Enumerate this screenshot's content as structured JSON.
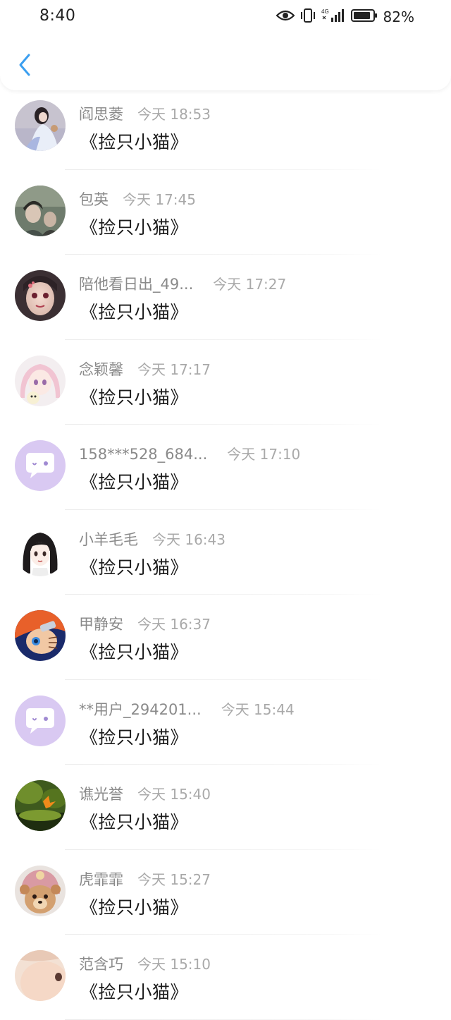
{
  "status_bar": {
    "time": "8:40",
    "battery_percent": "82%",
    "network": "4G",
    "icons": [
      "eye-icon",
      "vibrate-icon",
      "signal-icon",
      "battery-icon"
    ]
  },
  "header": {
    "back_icon": "chevron-left-icon",
    "accent_color": "#3b9ff0"
  },
  "list": [
    {
      "name": "阎思菱",
      "time": "今天 18:53",
      "content": "《捡只小猫》",
      "avatar": "photo"
    },
    {
      "name": "包英",
      "time": "今天 17:45",
      "content": "《捡只小猫》",
      "avatar": "photo"
    },
    {
      "name": "陪他看日出_49...",
      "time": "今天 17:27",
      "content": "《捡只小猫》",
      "avatar": "photo"
    },
    {
      "name": "念颖馨",
      "time": "今天 17:17",
      "content": "《捡只小猫》",
      "avatar": "photo"
    },
    {
      "name": "158***528_684...",
      "time": "今天 17:10",
      "content": "《捡只小猫》",
      "avatar": "default-chat-bubble"
    },
    {
      "name": "小羊毛毛",
      "time": "今天 16:43",
      "content": "《捡只小猫》",
      "avatar": "photo"
    },
    {
      "name": "甲静安",
      "time": "今天 16:37",
      "content": "《捡只小猫》",
      "avatar": "photo"
    },
    {
      "name": "**用户_294201...",
      "time": "今天 15:44",
      "content": "《捡只小猫》",
      "avatar": "default-chat-bubble"
    },
    {
      "name": "谯光誉",
      "time": "今天 15:40",
      "content": "《捡只小猫》",
      "avatar": "photo"
    },
    {
      "name": "虎霏霏",
      "time": "今天 15:27",
      "content": "《捡只小猫》",
      "avatar": "photo"
    },
    {
      "name": "范含巧",
      "time": "今天 15:10",
      "content": "《捡只小猫》",
      "avatar": "photo"
    }
  ]
}
